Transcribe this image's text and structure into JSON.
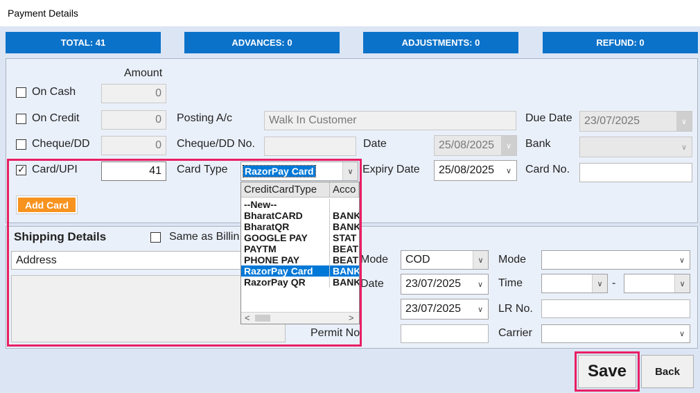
{
  "window": {
    "title": "Payment Details"
  },
  "summary": {
    "total": "TOTAL: 41",
    "advances": "ADVANCES: 0",
    "adjustments": "ADJUSTMENTS: 0",
    "refund": "REFUND: 0"
  },
  "payment": {
    "amount_header": "Amount",
    "on_cash": {
      "label": "On Cash",
      "checked": false,
      "amount": "0"
    },
    "on_credit": {
      "label": "On Credit",
      "checked": false,
      "amount": "0"
    },
    "cheque_dd": {
      "label": "Cheque/DD",
      "checked": false,
      "amount": "0"
    },
    "card_upi": {
      "label": "Card/UPI",
      "checked": true,
      "amount": "41"
    },
    "posting_ac_label": "Posting A/c",
    "posting_ac_value": "Walk In Customer",
    "due_date_label": "Due Date",
    "due_date_value": "23/07/2025",
    "cheque_no_label": "Cheque/DD No.",
    "cheque_no_value": "",
    "date_label": "Date",
    "date_value": "25/08/2025",
    "bank_label": "Bank",
    "bank_value": "",
    "card_type_label": "Card Type",
    "card_type_value": "RazorPay Card",
    "expiry_label": "Expiry Date",
    "expiry_value": "25/08/2025",
    "card_no_label": "Card No.",
    "card_no_value": "",
    "add_card_label": "Add Card"
  },
  "card_dropdown": {
    "columns": [
      "CreditCardType",
      "Acco"
    ],
    "rows": [
      {
        "type": "--New--",
        "account": ""
      },
      {
        "type": "BharatCARD",
        "account": "BANK"
      },
      {
        "type": "BharatQR",
        "account": "BANK"
      },
      {
        "type": "GOOGLE PAY",
        "account": "STAT"
      },
      {
        "type": "PAYTM",
        "account": "BEAT"
      },
      {
        "type": "PHONE PAY",
        "account": "BEAT"
      },
      {
        "type": "RazorPay Card",
        "account": "BANK"
      },
      {
        "type": "RazorPay QR",
        "account": "BANK"
      }
    ],
    "selected_index": 6
  },
  "shipping": {
    "title": "Shipping Details",
    "same_as_billing_label": "Same as Billin",
    "address_label": "Address",
    "mode_label_left": "Mode",
    "mode_value_left": "COD",
    "date_label": "Date",
    "date_value_1": "23/07/2025",
    "date_value_2": "23/07/2025",
    "permit_label": "Permit No",
    "permit_value": "",
    "mode_label_right": "Mode",
    "mode_value_right": "",
    "time_label": "Time",
    "time_separator": "-",
    "lr_label": "LR No.",
    "lr_value": "",
    "carrier_label": "Carrier",
    "carrier_value": ""
  },
  "buttons": {
    "save": "Save",
    "back": "Back"
  }
}
